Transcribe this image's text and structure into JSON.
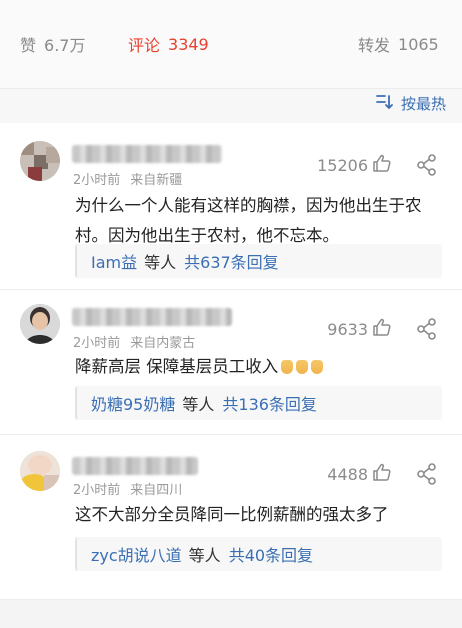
{
  "tabs": {
    "like": {
      "label": "赞",
      "count": "6.7万"
    },
    "comment": {
      "label": "评论",
      "count": "3349"
    },
    "repost": {
      "label": "转发",
      "count": "1065"
    }
  },
  "sort": {
    "label": "按最热"
  },
  "comments": [
    {
      "likes": "15206",
      "time": "2小时前",
      "location": "来自新疆",
      "text": "为什么一个人能有这样的胸襟，因为他出生于农村。因为他出生于农村，他不忘本。",
      "reply_user": "Iam益",
      "reply_mid": "等人",
      "reply_count": "共637条回复"
    },
    {
      "likes": "9633",
      "time": "2小时前",
      "location": "来自内蒙古",
      "text": "降薪高层 保障基层员工收入",
      "reply_user": "奶糖95奶糖",
      "reply_mid": "等人",
      "reply_count": "共136条回复"
    },
    {
      "likes": "4488",
      "time": "2小时前",
      "location": "来自四川",
      "text": "这不大部分全员降同一比例薪酬的强太多了",
      "reply_user": "zyc胡说八道",
      "reply_mid": "等人",
      "reply_count": "共40条回复"
    }
  ]
}
